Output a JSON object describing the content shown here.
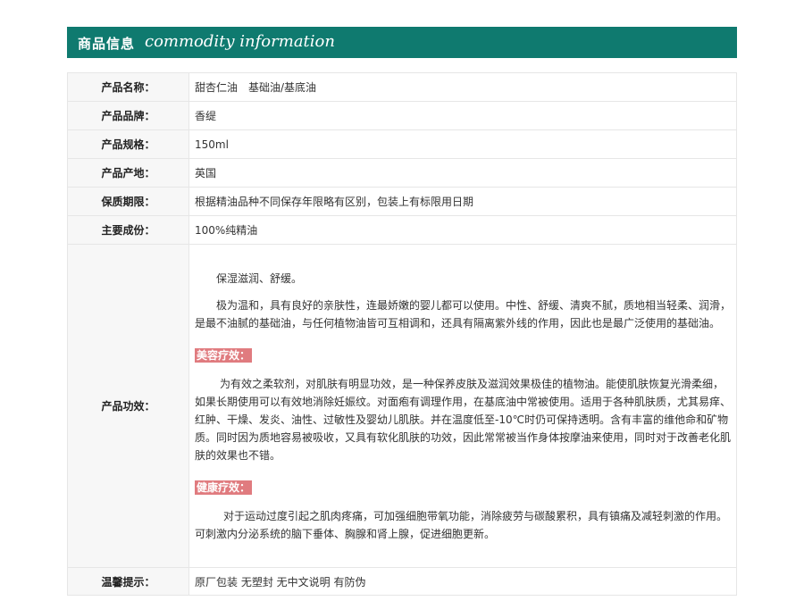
{
  "header": {
    "title_cn": "商品信息",
    "title_en": "commodity information"
  },
  "colors": {
    "header_bg": "#0f7a6f",
    "tag_bg": "#e07b7f"
  },
  "rows": [
    {
      "label": "产品名称：",
      "value": "甜杏仁油　基础油/基底油"
    },
    {
      "label": "产品品牌：",
      "value": "香缇"
    },
    {
      "label": "产品规格：",
      "value": "150ml"
    },
    {
      "label": "产品产地：",
      "value": "英国"
    },
    {
      "label": "保质期限：",
      "value": "根据精油品种不同保存年限略有区别，包装上有标限用日期"
    },
    {
      "label": "主要成份：",
      "value": "100%纯精油"
    }
  ],
  "effect": {
    "label": "产品功效：",
    "intro": "保湿滋润、舒缓。",
    "desc": "极为温和，具有良好的亲肤性，连最娇嫩的婴儿都可以使用。中性、舒缓、清爽不腻，质地相当轻柔、润滑，是最不油腻的基础油，与任何植物油皆可互相调和，还具有隔离紫外线的作用，因此也是最广泛使用的基础油。",
    "beauty_tag": "美容疗效：",
    "beauty_text": "为有效之柔软剂，对肌肤有明显功效，是一种保养皮肤及滋润效果极佳的植物油。能使肌肤恢复光滑柔细，如果长期使用可以有效地消除妊娠纹。对面疱有调理作用，在基底油中常被使用。适用于各种肌肤质，尤其易痒、红肿、干燥、发炎、油性、过敏性及婴幼儿肌肤。并在温度低至-10℃时仍可保持透明。含有丰富的维他命和矿物质。同时因为质地容易被吸收，又具有软化肌肤的功效，因此常常被当作身体按摩油来使用，同时对于改善老化肌肤的效果也不错。",
    "health_tag": "健康疗效：",
    "health_text": "对于运动过度引起之肌肉疼痛，可加强细胞带氧功能，消除疲劳与碳酸累积，具有镇痛及减轻刺激的作用。可刺激内分泌系统的脑下垂体、胸腺和肾上腺，促进细胞更新。"
  },
  "tips": {
    "label": "温馨提示：",
    "value": "原厂包装 无塑封 无中文说明 有防伪"
  }
}
